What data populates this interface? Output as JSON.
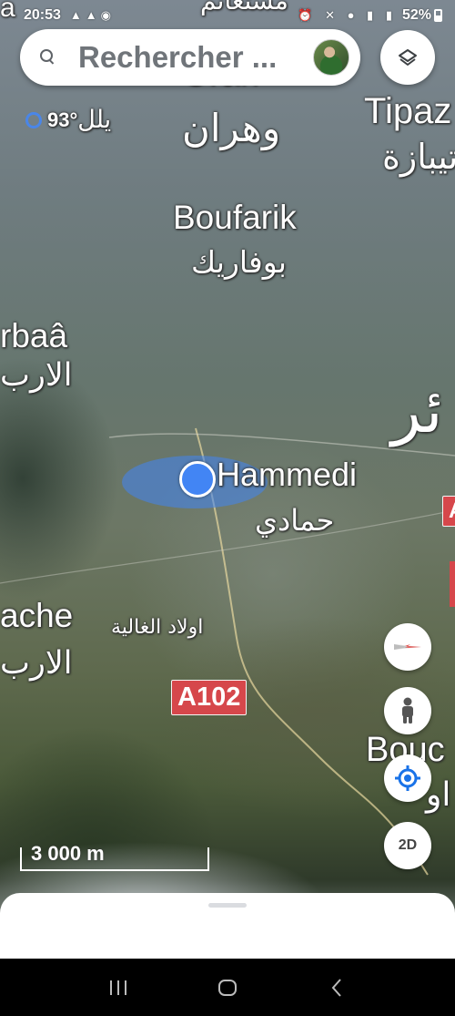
{
  "status_bar": {
    "time": "20:53",
    "battery": "52%"
  },
  "search": {
    "placeholder": "Rechercher ..."
  },
  "map": {
    "weather": {
      "temperature": "93°",
      "partial_label": "يلل"
    },
    "labels": [
      {
        "key": "oran_fr",
        "text": "Oran"
      },
      {
        "key": "oran_ar",
        "text": "وهران"
      },
      {
        "key": "tipaza_fr",
        "text": "Tipaz"
      },
      {
        "key": "tipaza_ar",
        "text": "تيبازة"
      },
      {
        "key": "boufarik_fr",
        "text": "Boufarik"
      },
      {
        "key": "boufarik_ar",
        "text": "بوفاريك"
      },
      {
        "key": "larbaa_fr",
        "text": "rbaâ"
      },
      {
        "key": "larbaa_ar",
        "text": "الارب"
      },
      {
        "key": "alger_ar",
        "text": "ئر"
      },
      {
        "key": "hammedi_fr",
        "text": "Hammedi"
      },
      {
        "key": "hammedi_ar",
        "text": "حمادي"
      },
      {
        "key": "larbatache_fr",
        "text": "ache"
      },
      {
        "key": "larbatache_ar",
        "text": "الارب"
      },
      {
        "key": "ouled_ar",
        "text": "اولاد الغالية"
      },
      {
        "key": "bouc_fr",
        "text": "Bouc"
      },
      {
        "key": "bouc_ar",
        "text": "او"
      },
      {
        "key": "top_fr",
        "text": "a"
      },
      {
        "key": "top_ar",
        "text": "مستغانم"
      }
    ],
    "road_shields": [
      {
        "key": "a102",
        "text": "A102"
      },
      {
        "key": "a_edge",
        "text": "A"
      }
    ],
    "scale": "3 000 m",
    "controls": {
      "view_2d": "2D"
    }
  },
  "colors": {
    "location_blue": "#4285f4",
    "road_shield_red": "#d6474b",
    "compass_red": "#e53935"
  }
}
